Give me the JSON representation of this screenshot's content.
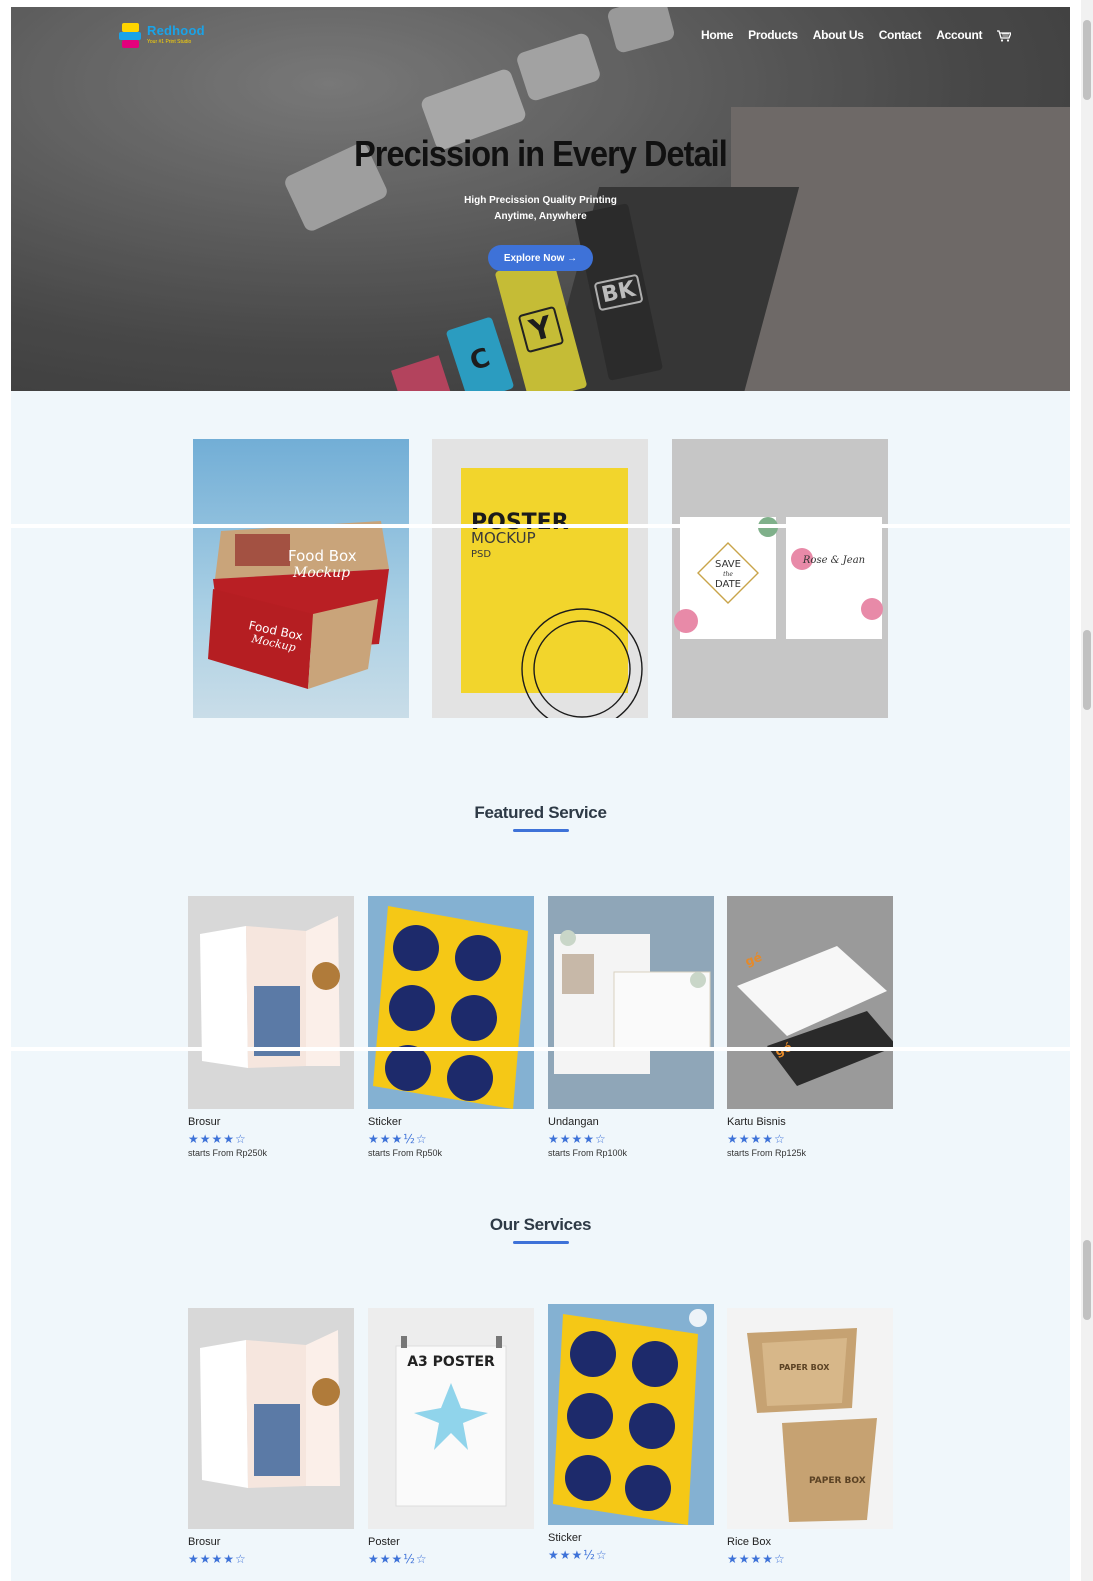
{
  "brand": {
    "name": "Redhood",
    "tagline": "Your #1 Print Studio"
  },
  "nav": {
    "items": [
      "Home",
      "Products",
      "About Us",
      "Contact",
      "Account"
    ],
    "cart_icon": "cart-icon"
  },
  "hero": {
    "title": "Precission in Every Detail",
    "subtitle_line1": "High Precission Quality Printing",
    "subtitle_line2": "Anytime, Anywhere",
    "button_label": "Explore Now →",
    "ink_labels": [
      "C",
      "Y",
      "BK"
    ]
  },
  "promo": {
    "food_box_text": "Food Box",
    "food_box_script": "Mockup",
    "poster_title": "POSTER",
    "poster_sub": "MOCKUP",
    "poster_psd": "PSD",
    "save_date": [
      "SAVE",
      "the",
      "DATE"
    ],
    "invite_names": "Rose & Jean"
  },
  "featured": {
    "title": "Featured Service",
    "cards": [
      {
        "name": "Brosur",
        "stars": "★★★★☆",
        "price": "starts From Rp250k"
      },
      {
        "name": "Sticker",
        "stars": "★★★½☆",
        "price": "starts From Rp50k"
      },
      {
        "name": "Undangan",
        "stars": "★★★★☆",
        "price": "starts From Rp100k"
      },
      {
        "name": "Kartu Bisnis",
        "stars": "★★★★☆",
        "price": "starts From Rp125k"
      }
    ]
  },
  "services": {
    "title": "Our Services",
    "cards": [
      {
        "name": "Brosur",
        "stars": "★★★★☆"
      },
      {
        "name": "Poster",
        "stars": "★★★½☆",
        "poster_text": "A3 POSTER"
      },
      {
        "name": "Sticker",
        "stars": "★★★½☆"
      },
      {
        "name": "Rice Box",
        "stars": "★★★★☆",
        "box_text": "PAPER BOX"
      }
    ]
  },
  "colors": {
    "accent": "#3e72d8",
    "page_bg": "#f0f7fb",
    "sticker_yellow": "#f5c816",
    "sticker_navy": "#1d2a6b"
  }
}
